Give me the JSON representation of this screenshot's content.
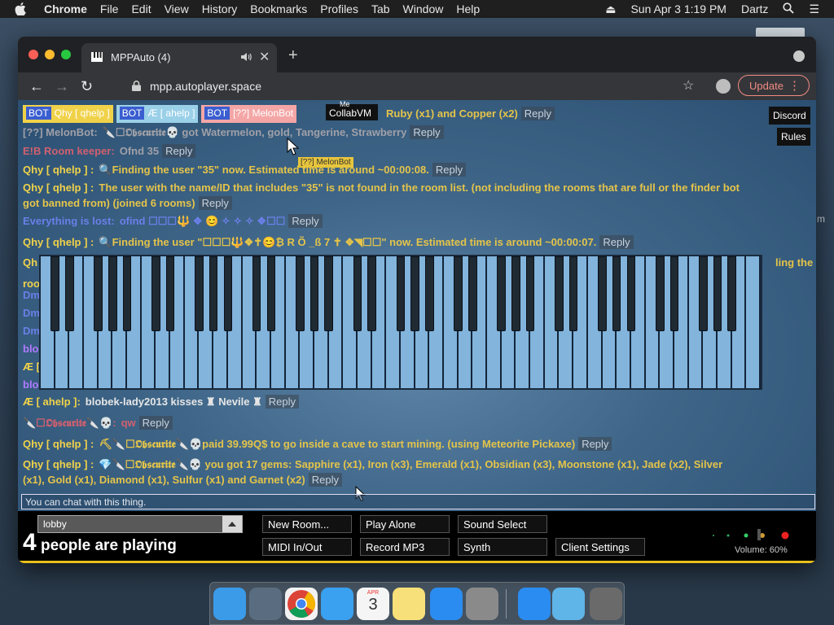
{
  "menubar": {
    "app": "Chrome",
    "items": [
      "File",
      "Edit",
      "View",
      "History",
      "Bookmarks",
      "Profiles",
      "Tab",
      "Window",
      "Help"
    ],
    "datetime": "Sun Apr 3  1:19 PM",
    "user": "Dartz"
  },
  "browser": {
    "tab_title": "MPPAuto (4)",
    "url": "mpp.autoplayer.space",
    "update_label": "Update"
  },
  "top_tags": [
    {
      "bot": "BOT",
      "name": "Qhy [ qhelp ]",
      "bg": "#f0d24a",
      "color": "#fff"
    },
    {
      "bot": "BOT",
      "name": "Æ [ ahelp ]",
      "bg": "#9ad0e8",
      "color": "#fff"
    },
    {
      "bot": "BOT",
      "name": "[??] MelonBot",
      "bg": "#f4a6a6",
      "color": "#fff"
    }
  ],
  "collab": {
    "me": "Me",
    "label": "CollabVM"
  },
  "melon_tip": "[??] MelonBot",
  "side_buttons": {
    "discord": "Discord",
    "rules": "Rules"
  },
  "chat": [
    {
      "user": "",
      "text": "Ruby (x1) and Copper (x2)",
      "reply": "Reply"
    },
    {
      "user": "[??] MelonBot:",
      "text": "🔪☐𝕺𝖇𝖘𝖈𝖚𝖗𝖎𝖙𝖊💀 got Watermelon, gold, Tangerine, Strawberry",
      "reply": "Reply"
    },
    {
      "user": "E!B Room keeper:",
      "text": "Ofnd 35",
      "reply": "Reply"
    },
    {
      "user": "Qhy [ qhelp ] :",
      "text": "🔍Finding the user \"35\" now. Estimated time is around ~00:00:08.",
      "reply": "Reply"
    },
    {
      "user": "Qhy [ qhelp ] :",
      "text": "The user with the name/ID that includes \"35\" is not found in the room list. (not including the rooms that are full or the finder bot",
      "text2": "got banned from) (joined 6 rooms)",
      "reply": "Reply"
    },
    {
      "user": "Everything is lost:",
      "text": "ofind ☐☐☐🔱 ❖ 😊 ✧ ✧ ✧ ❖☐☐",
      "reply": "Reply"
    },
    {
      "user": "Qhy [ qhelp ] :",
      "text": "🔍Finding the user \"☐☐☐🔱❖✝😊₿ R Õ _ß 7 ✝ ❖◥☐☐\" now. Estimated time is around ~00:00:07.",
      "reply": "Reply"
    },
    {
      "user": "Qh",
      "text": "",
      "tail": "ling the"
    },
    {
      "user": "roo",
      "text": ""
    },
    {
      "user": "Dm",
      "text": ""
    },
    {
      "user": "Dm",
      "text": ""
    },
    {
      "user": "Dm",
      "text": ""
    },
    {
      "user": "blo",
      "text": ""
    },
    {
      "user": "Æ [",
      "text": ""
    },
    {
      "user": "blo",
      "text": ""
    },
    {
      "user": "Æ [ ahelp ]:",
      "text": "blobek-lady2013 kisses ♜ Nevile ♜",
      "reply": "Reply"
    },
    {
      "user": "🔪☐𝕺𝖇𝖘𝖈𝖚𝖗𝖎𝖙𝖊🔪💀:",
      "text": "qw",
      "reply": "Reply"
    },
    {
      "user": "Qhy [ qhelp ] :",
      "text": "⛏🔪☐𝕺𝖇𝖘𝖈𝖚𝖗𝖎𝖙𝖊🔪💀paid 39.99Q$ to go inside a cave to start mining. (using Meteorite Pickaxe)",
      "reply": "Reply"
    },
    {
      "user": "Qhy [ qhelp ] :",
      "text": "💎🔪☐𝕺𝖇𝖘𝖈𝖚𝖗𝖎𝖙𝖊🔪💀 you got 17 gems: Sapphire (x1), Iron (x3), Emerald (x1), Obsidian (x3), Moonstone (x1), Jade (x2), Silver",
      "text2": "(x1), Gold (x1), Diamond (x1), Sulfur (x1) and Garnet (x2)",
      "reply": "Reply"
    }
  ],
  "chat_input_placeholder": "You can chat with this thing.",
  "room": "lobby",
  "players_count": "4",
  "players_text": "people are playing",
  "buttons": {
    "new_room": "New Room...",
    "play_alone": "Play Alone",
    "sound_select": "Sound Select",
    "midi": "MIDI In/Out",
    "record": "Record MP3",
    "synth": "Synth",
    "client_settings": "Client Settings"
  },
  "volume": "Volume: 60%",
  "side_letter": "m",
  "dock": [
    "finder-icon",
    "launchpad-icon",
    "chrome-icon",
    "safari-icon",
    "calendar-icon",
    "notes-icon",
    "app-store-icon",
    "system-preferences-icon",
    "app-store-icon",
    "downloads-folder-icon",
    "trash-icon"
  ],
  "calendar": {
    "month": "APR",
    "day": "3"
  }
}
